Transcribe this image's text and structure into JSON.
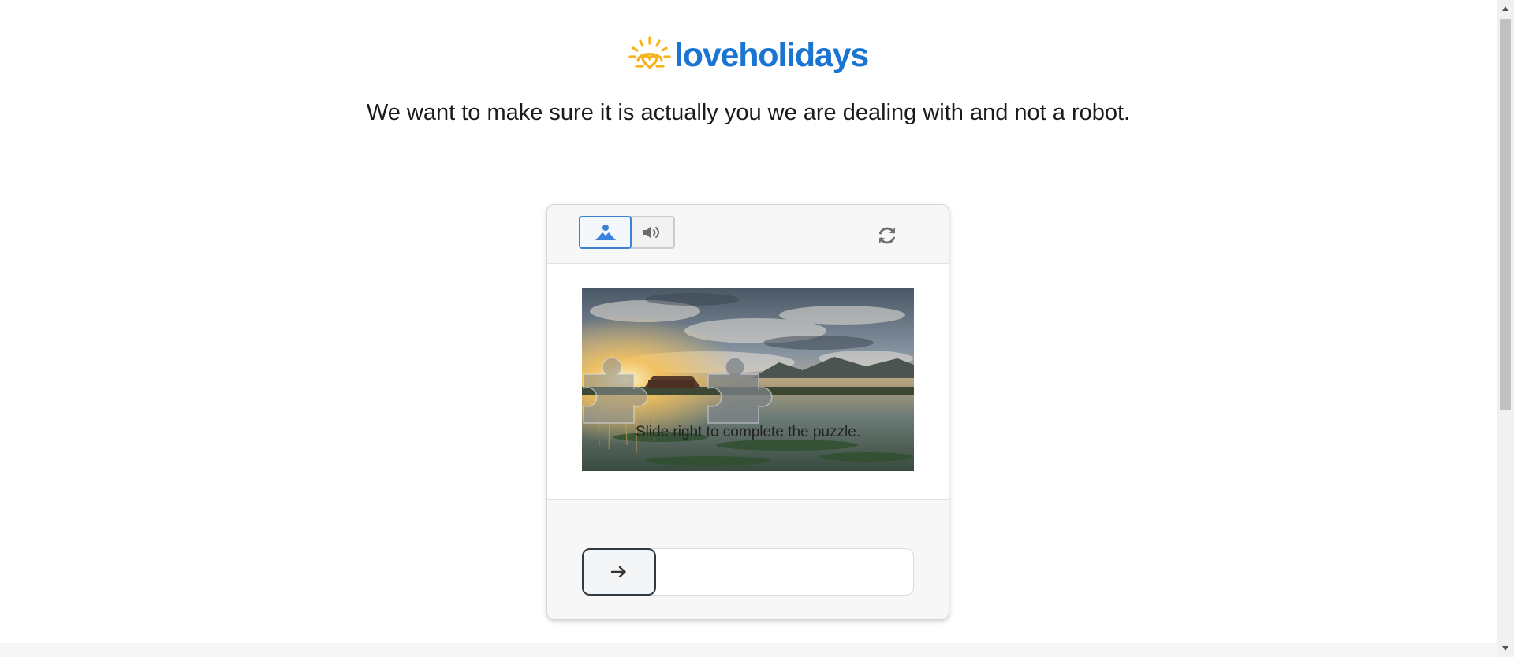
{
  "brand": {
    "name": "loveholidays",
    "logo_icon": "sun-heart-icon",
    "colors": {
      "wordmark": "#1a74d2",
      "sun": "#f6b41a"
    }
  },
  "headline": "We want to make sure it is actually you we are dealing with and not a robot.",
  "captcha": {
    "modes": [
      {
        "name": "image",
        "icon": "image-icon",
        "selected": true
      },
      {
        "name": "audio",
        "icon": "speaker-icon",
        "selected": false
      }
    ],
    "refresh_icon": "refresh-icon",
    "instruction": "Slide right to complete the puzzle.",
    "slider": {
      "handle_icon": "arrow-right-icon",
      "progress": 0
    },
    "accent_color": "#3b82d8"
  }
}
